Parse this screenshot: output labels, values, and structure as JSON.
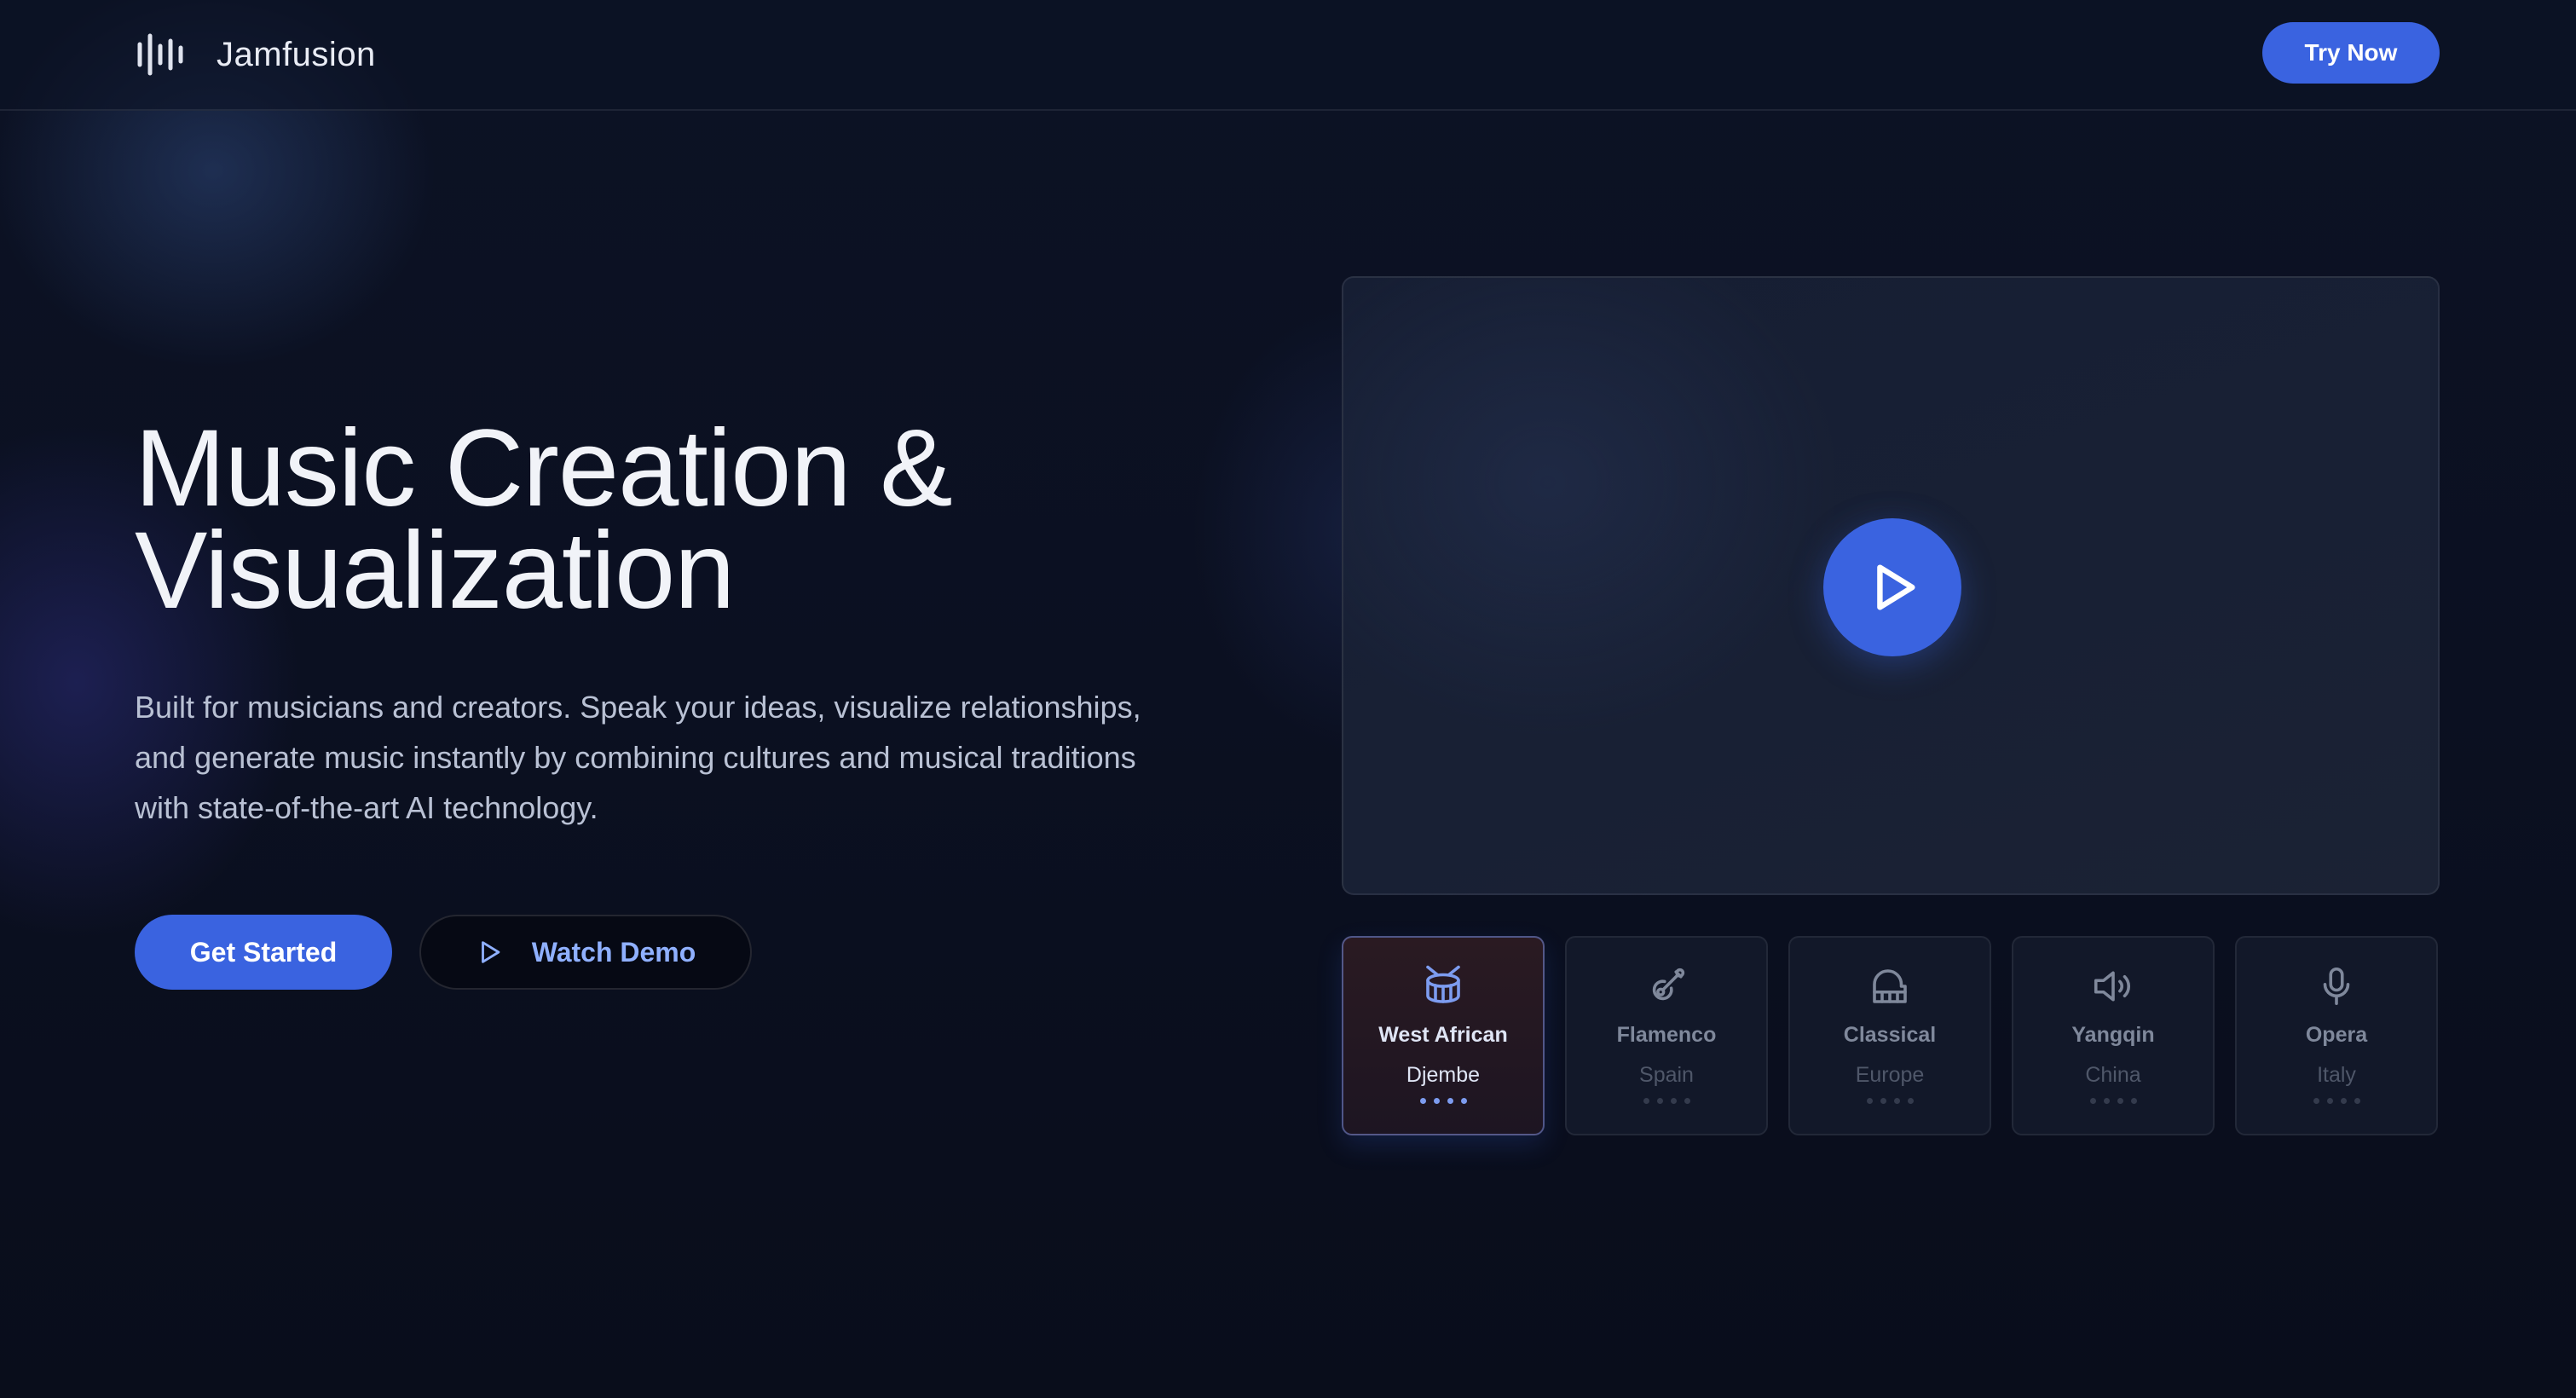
{
  "header": {
    "brand_name": "Jamfusion",
    "try_label": "Try Now"
  },
  "hero": {
    "title_line1": "Music Creation &",
    "title_line2": "Visualization",
    "description": "Built for musicians and creators. Speak your ideas, visualize relationships, and generate music instantly by combining cultures and musical traditions with state-of-the-art AI technology.",
    "primary_label": "Get Started",
    "secondary_label": "Watch Demo"
  },
  "video": {
    "play_icon": "play-icon"
  },
  "cards": [
    {
      "name": "West African",
      "sub": "Djembe",
      "icon": "drum-icon",
      "active": true
    },
    {
      "name": "Flamenco",
      "sub": "Spain",
      "icon": "guitar-icon",
      "active": false
    },
    {
      "name": "Classical",
      "sub": "Europe",
      "icon": "piano-icon",
      "active": false
    },
    {
      "name": "Yangqin",
      "sub": "China",
      "icon": "speaker-icon",
      "active": false
    },
    {
      "name": "Opera",
      "sub": "Italy",
      "icon": "microphone-icon",
      "active": false
    }
  ],
  "colors": {
    "accent": "#3a63e0",
    "accent_text": "#8fb0ff",
    "background": "#0b1020",
    "active_icon": "#7d9cf0",
    "inactive_icon": "#7f889b"
  }
}
